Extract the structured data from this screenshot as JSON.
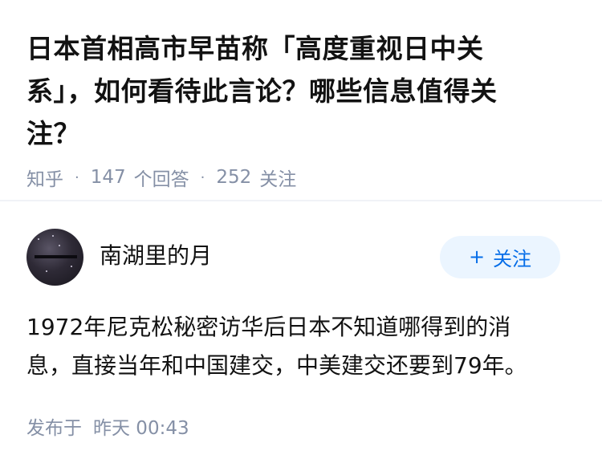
{
  "question": {
    "title": "日本首相高市早苗称「高度重视日中关系」，如何看待此言论？哪些信息值得关注？",
    "source": "知乎",
    "answer_count": "147",
    "answer_label": "个回答",
    "follower_count": "252",
    "follower_label": "关注"
  },
  "author": {
    "name": "南湖里的月",
    "follow_label": "关注",
    "follow_icon": "plus-icon"
  },
  "answer": {
    "text": "1972年尼克松秘密访华后日本不知道哪得到的消息，直接当年和中国建交，中美建交还要到79年。",
    "publish_label": "发布于",
    "publish_time": "昨天 00:43"
  },
  "colors": {
    "title": "#121212",
    "meta": "#8590a6",
    "accent": "#056de8",
    "follow_bg": "#ebf5ff"
  }
}
